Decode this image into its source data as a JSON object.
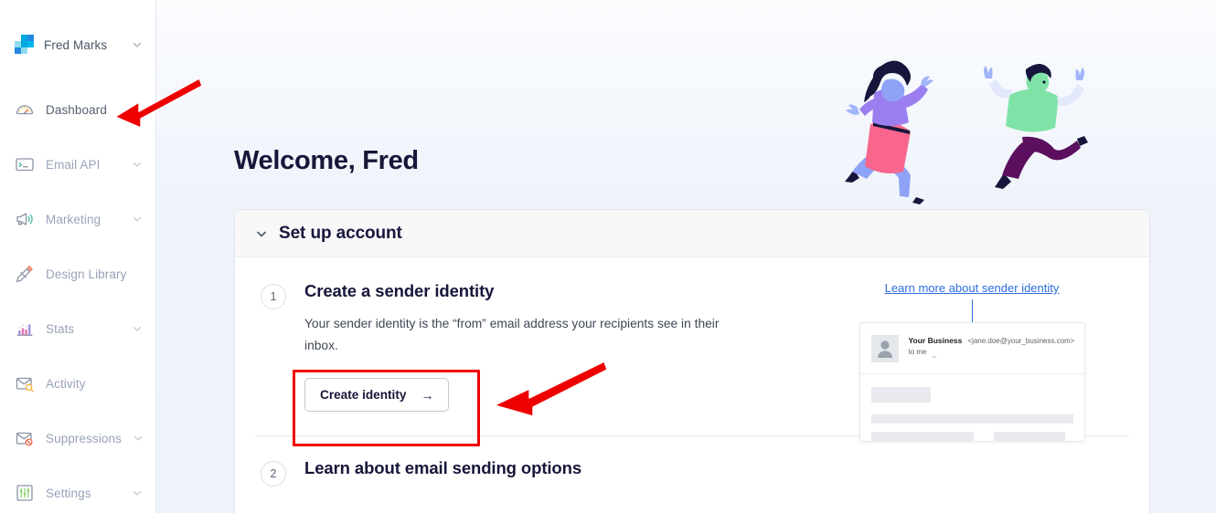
{
  "sidebar": {
    "brand": {
      "name": "Fred Marks",
      "logo_icon": "pixel-squares-logo",
      "chevron_icon": "chevron-down-icon"
    },
    "items": [
      {
        "label": "Dashboard",
        "icon": "gauge-icon",
        "has_chevron": false,
        "active": true
      },
      {
        "label": "Email API",
        "icon": "terminal-icon",
        "has_chevron": true,
        "active": false
      },
      {
        "label": "Marketing",
        "icon": "megaphone-icon",
        "has_chevron": true,
        "active": false
      },
      {
        "label": "Design Library",
        "icon": "pencil-ruler-icon",
        "has_chevron": false,
        "active": false
      },
      {
        "label": "Stats",
        "icon": "bar-chart-icon",
        "has_chevron": true,
        "active": false
      },
      {
        "label": "Activity",
        "icon": "envelope-search-icon",
        "has_chevron": false,
        "active": false
      },
      {
        "label": "Suppressions",
        "icon": "envelope-block-icon",
        "has_chevron": true,
        "active": false
      },
      {
        "label": "Settings",
        "icon": "sliders-icon",
        "has_chevron": true,
        "active": false
      }
    ]
  },
  "main": {
    "welcome_title": "Welcome, Fred",
    "illustration": "two-people-jumping-illustration",
    "card": {
      "header_title": "Set up account",
      "header_chevron_icon": "chevron-down-icon",
      "steps": [
        {
          "number": "1",
          "title": "Create a sender identity",
          "description": "Your sender identity is the “from” email address your recipients see in their inbox.",
          "button_label": "Create identity",
          "button_arrow": "→",
          "link_label": "Learn more about sender identity",
          "preview": {
            "avatar_icon": "person-avatar-icon",
            "from_name": "Your Business",
            "from_address": "<jane.doe@your_business.com>",
            "to_label": "to me",
            "caret_icon": "caret-down-icon"
          }
        },
        {
          "number": "2",
          "title": "Learn about email sending options"
        }
      ]
    }
  },
  "annotations": {
    "highlight_box_color": "#ef0000",
    "arrow_color": "#ef0000",
    "arrow_to_dashboard": "red-arrow-pointing-to-dashboard",
    "arrow_to_create_identity": "red-arrow-pointing-to-create-identity-button",
    "highlight_box": "red-highlight-box-around-create-identity-button"
  },
  "colors": {
    "accent_link": "#2d6cdf",
    "heading": "#17163a",
    "sidebar_text": "#98a2b8",
    "page_background": "#eff4fb"
  }
}
